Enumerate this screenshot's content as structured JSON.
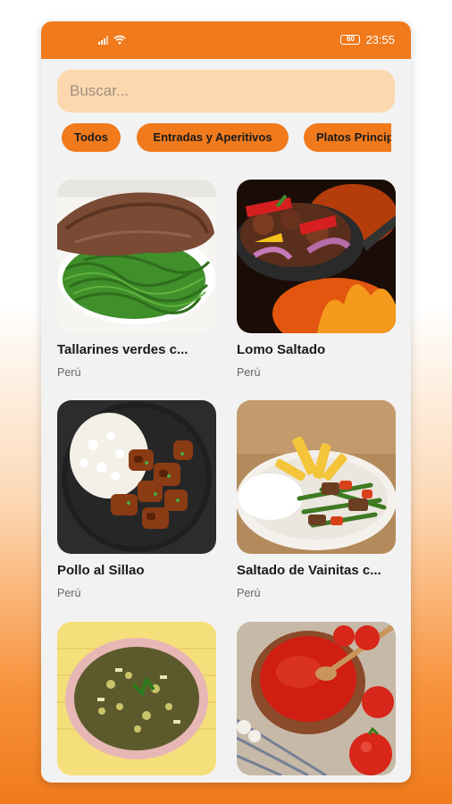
{
  "status": {
    "time": "23:55",
    "battery": "60"
  },
  "search": {
    "placeholder": "Buscar..."
  },
  "categories": [
    "Todos",
    "Entradas y Aperitivos",
    "Platos Principales"
  ],
  "recipes": [
    {
      "title": "Tallarines verdes c...",
      "origin": "Perú"
    },
    {
      "title": "Lomo Saltado",
      "origin": "Perú"
    },
    {
      "title": "Pollo al Sillao",
      "origin": "Perú"
    },
    {
      "title": "Saltado de Vainitas c...",
      "origin": "Perú"
    },
    {
      "title": "",
      "origin": ""
    },
    {
      "title": "",
      "origin": ""
    }
  ],
  "colors": {
    "accent": "#f07a1c",
    "search_bg": "#fcd8ae",
    "background": "#f2f2f2"
  }
}
